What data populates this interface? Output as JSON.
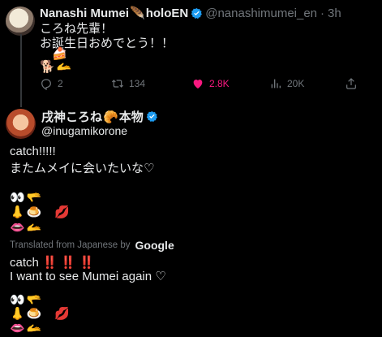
{
  "reply_tweet": {
    "display_name": "Nanashi Mumei",
    "name_suffix": "holoEN",
    "name_emoji": "🪶",
    "handle": "@nanashimumei_en",
    "separator": "·",
    "time": "3h",
    "lines": [
      "ころね先輩！",
      "お誕生日おめでとう！！"
    ],
    "emoji_line1": "🍰",
    "emoji_line2": [
      "🐕",
      "🫴"
    ],
    "actions": {
      "replies": "2",
      "retweets": "134",
      "likes": "2.8K",
      "views": "20K"
    },
    "colors": {
      "like_active": "#f91880"
    }
  },
  "main_tweet": {
    "display_name": "戌神ころね",
    "name_emoji": "🥐",
    "name_suffix": "本物",
    "handle": "@inugamikorone",
    "text_lines": [
      "catch!!!!!",
      "またムメイに会いたいな♡"
    ],
    "emoji_lines": [
      [
        "👀",
        "🫳"
      ],
      [
        "👃",
        "🍮",
        "💋"
      ],
      [
        "👄",
        "🫴"
      ]
    ],
    "translation_label": "Translated from Japanese by",
    "translation_provider": "Google",
    "translated_word": "catch",
    "translated_bangs": "‼️ ‼️ ‼️",
    "translated_line2": "I want to see Mumei again ♡"
  },
  "colors": {
    "background": "#000000",
    "text": "#e7e9ea",
    "muted": "#71767b",
    "verified": "#1d9bf0"
  }
}
